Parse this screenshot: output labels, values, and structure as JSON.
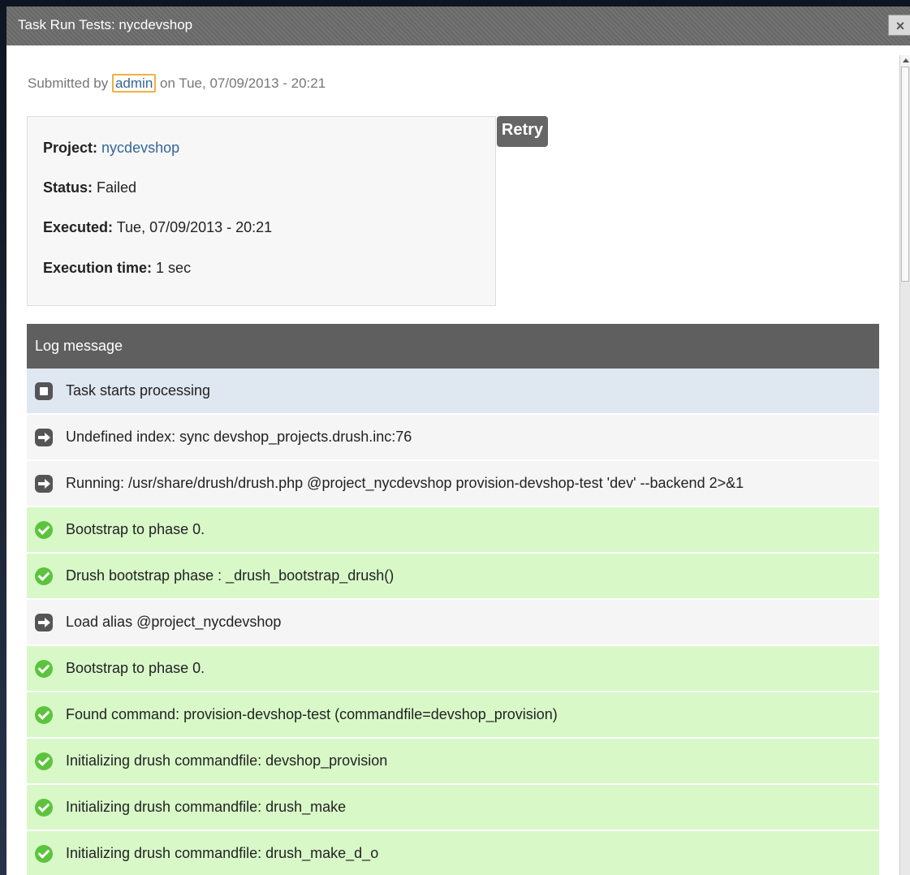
{
  "dialog": {
    "title": "Task Run Tests: nycdevshop",
    "close_label": "×"
  },
  "submitted": {
    "prefix": "Submitted by",
    "user": "admin",
    "suffix": "on Tue, 07/09/2013 - 20:21"
  },
  "info": {
    "project_label": "Project:",
    "project_value": "nycdevshop",
    "status_label": "Status:",
    "status_value": "Failed",
    "executed_label": "Executed:",
    "executed_value": "Tue, 07/09/2013 - 20:21",
    "time_label": "Execution time:",
    "time_value": "1 sec"
  },
  "retry_label": "Retry",
  "log": {
    "header": "Log message",
    "rows": [
      {
        "type": "info",
        "icon": "square-icon",
        "text": "Task starts processing"
      },
      {
        "type": "notice",
        "icon": "arrow-right-icon",
        "text": "Undefined index: sync devshop_projects.drush.inc:76"
      },
      {
        "type": "notice",
        "icon": "arrow-right-icon",
        "text": "Running: /usr/share/drush/drush.php @project_nycdevshop provision-devshop-test 'dev' --backend 2>&1"
      },
      {
        "type": "success",
        "icon": "check-icon",
        "text": "Bootstrap to phase 0."
      },
      {
        "type": "success",
        "icon": "check-icon",
        "text": "Drush bootstrap phase : _drush_bootstrap_drush()"
      },
      {
        "type": "notice",
        "icon": "arrow-right-icon",
        "text": "Load alias @project_nycdevshop"
      },
      {
        "type": "success",
        "icon": "check-icon",
        "text": "Bootstrap to phase 0."
      },
      {
        "type": "success",
        "icon": "check-icon",
        "text": "Found command: provision-devshop-test (commandfile=devshop_provision)"
      },
      {
        "type": "success",
        "icon": "check-icon",
        "text": "Initializing drush commandfile: devshop_provision"
      },
      {
        "type": "success",
        "icon": "check-icon",
        "text": "Initializing drush commandfile: drush_make"
      },
      {
        "type": "success",
        "icon": "check-icon",
        "text": "Initializing drush commandfile: drush_make_d_o"
      }
    ]
  },
  "colors": {
    "titlebar": "#6b6b6b",
    "log_header": "#5f5f5f",
    "success_row": "#d8f8c8",
    "notice_row": "#f5f5f5",
    "info_row": "#dfe7f0",
    "link": "#336699"
  }
}
